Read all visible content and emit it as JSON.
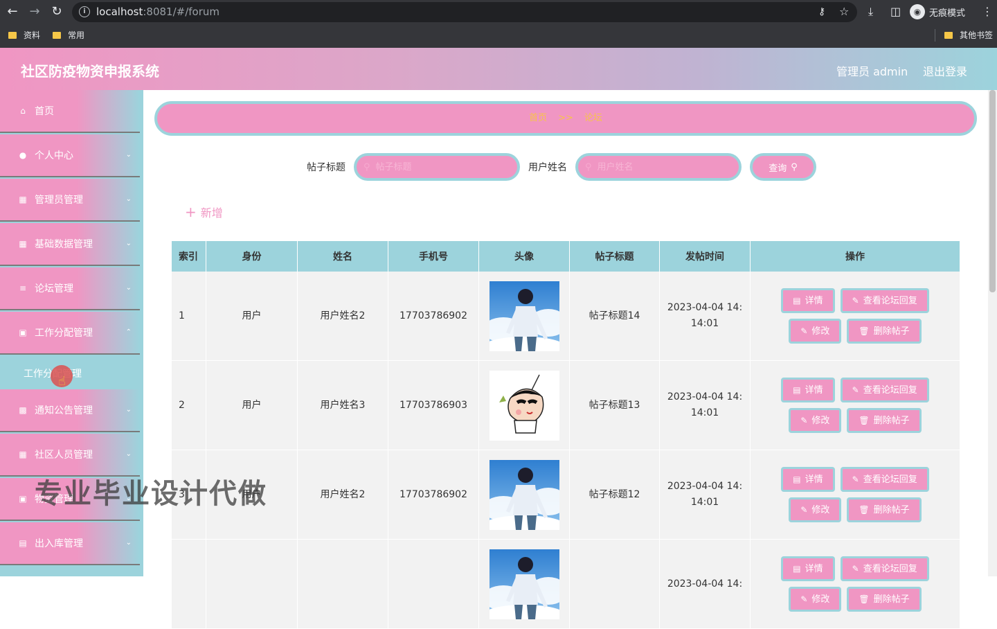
{
  "browser": {
    "url_host": "localhost",
    "url_rest": ":8081/#/forum",
    "incognito_label": "无痕模式",
    "bookmarks": [
      "资料",
      "常用"
    ],
    "other_bookmarks": "其他书签"
  },
  "header": {
    "title": "社区防疫物资申报系统",
    "admin_label": "管理员 admin",
    "logout": "退出登录"
  },
  "sidebar": {
    "items": [
      {
        "label": "首页",
        "icon": "home-icon"
      },
      {
        "label": "个人中心",
        "icon": "user-icon"
      },
      {
        "label": "管理员管理",
        "icon": "grid-icon"
      },
      {
        "label": "基础数据管理",
        "icon": "grid-icon"
      },
      {
        "label": "论坛管理",
        "icon": "sliders-icon"
      },
      {
        "label": "工作分配管理",
        "icon": "monitor-icon"
      },
      {
        "label": "通知公告管理",
        "icon": "chart-icon"
      },
      {
        "label": "社区人员管理",
        "icon": "grid-icon"
      },
      {
        "label": "物资管理",
        "icon": "image-icon"
      },
      {
        "label": "出入库管理",
        "icon": "clipboard-icon"
      }
    ],
    "submenu_label": "工作分配管理"
  },
  "breadcrumb": {
    "home": "首页",
    "separator": ">>",
    "current": "论坛"
  },
  "search": {
    "title_label": "帖子标题",
    "title_placeholder": "帖子标题",
    "user_label": "用户姓名",
    "user_placeholder": "用户姓名",
    "button": "查询"
  },
  "add_button": "新增",
  "table": {
    "headers": [
      "索引",
      "身份",
      "姓名",
      "手机号",
      "头像",
      "帖子标题",
      "发帖时间",
      "操作"
    ],
    "rows": [
      {
        "index": "1",
        "role": "用户",
        "name": "用户姓名2",
        "phone": "17703786902",
        "title": "帖子标题14",
        "time_line1": "2023-04-04 14:",
        "time_line2": "14:01",
        "avatar": "boy"
      },
      {
        "index": "2",
        "role": "用户",
        "name": "用户姓名3",
        "phone": "17703786903",
        "title": "帖子标题13",
        "time_line1": "2023-04-04 14:",
        "time_line2": "14:01",
        "avatar": "cartoon"
      },
      {
        "index": "3",
        "role": "用户",
        "name": "用户姓名2",
        "phone": "17703786902",
        "title": "帖子标题12",
        "time_line1": "2023-04-04 14:",
        "time_line2": "14:01",
        "avatar": "boy"
      },
      {
        "index": "",
        "role": "",
        "name": "",
        "phone": "",
        "title": "",
        "time_line1": "2023-04-04 14:",
        "time_line2": "",
        "avatar": "boy"
      }
    ],
    "ops": {
      "detail": "详情",
      "view_replies": "查看论坛回复",
      "edit": "修改",
      "delete": "删除帖子"
    }
  },
  "watermark": "专业毕业设计代做"
}
